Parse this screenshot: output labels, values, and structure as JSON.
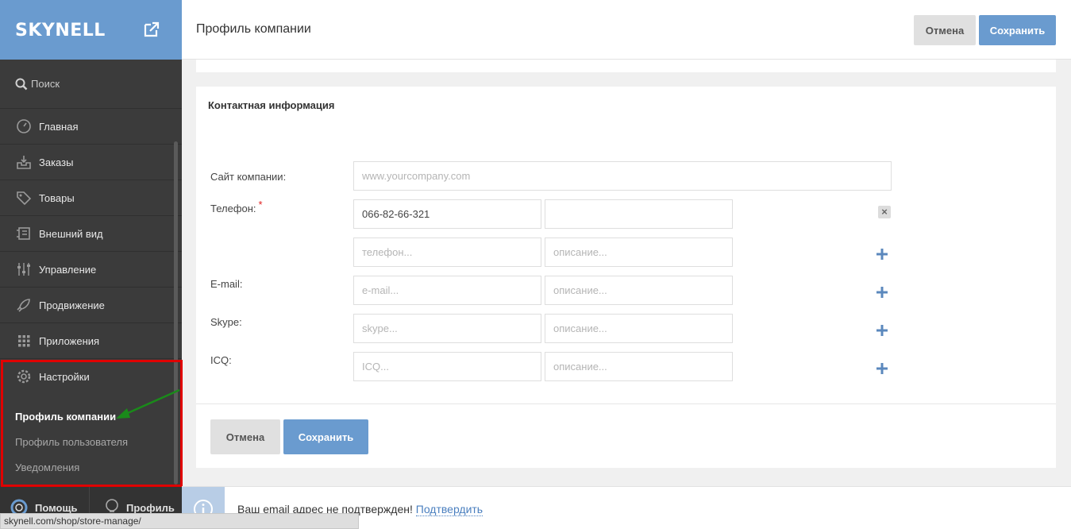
{
  "sidebar": {
    "logo": "SKYNELL",
    "search_label": "Поиск",
    "items": [
      {
        "label": "Главная",
        "icon": "dashboard-icon"
      },
      {
        "label": "Заказы",
        "icon": "inbox-icon"
      },
      {
        "label": "Товары",
        "icon": "tag-icon"
      },
      {
        "label": "Внешний вид",
        "icon": "layout-icon"
      },
      {
        "label": "Управление",
        "icon": "sliders-icon"
      },
      {
        "label": "Продвижение",
        "icon": "rocket-icon"
      },
      {
        "label": "Приложения",
        "icon": "grid-icon"
      },
      {
        "label": "Настройки",
        "icon": "gear-icon"
      }
    ],
    "sub_items": [
      {
        "label": "Профиль компании",
        "active": true
      },
      {
        "label": "Профиль пользователя",
        "active": false
      },
      {
        "label": "Уведомления",
        "active": false
      }
    ],
    "help_label": "Помощь",
    "profile_label": "Профиль"
  },
  "header": {
    "title": "Профиль компании",
    "cancel_label": "Отмена",
    "save_label": "Сохранить"
  },
  "contact": {
    "title": "Контактная информация",
    "website_label": "Сайт компании:",
    "website_placeholder": "www.yourcompany.com",
    "phone_label": "Телефон:",
    "phone_value": "066-82-66-321",
    "phone_placeholder": "телефон...",
    "desc_placeholder": "описание...",
    "email_label": "E-mail:",
    "email_placeholder": "e-mail...",
    "skype_label": "Skype:",
    "skype_placeholder": "skype...",
    "icq_label": "ICQ:",
    "icq_placeholder": "ICQ...",
    "cancel_label": "Отмена",
    "save_label": "Сохранить"
  },
  "notification": {
    "text": "Ваш email адрес не подтвержден!",
    "link": "Подтвердить"
  },
  "status_url": "skynell.com/shop/store-manage/",
  "colors": {
    "accent": "#6a9bcf",
    "sidebar": "#3b3b3b",
    "highlight": "#e00000",
    "arrow": "#1a8a1a"
  }
}
